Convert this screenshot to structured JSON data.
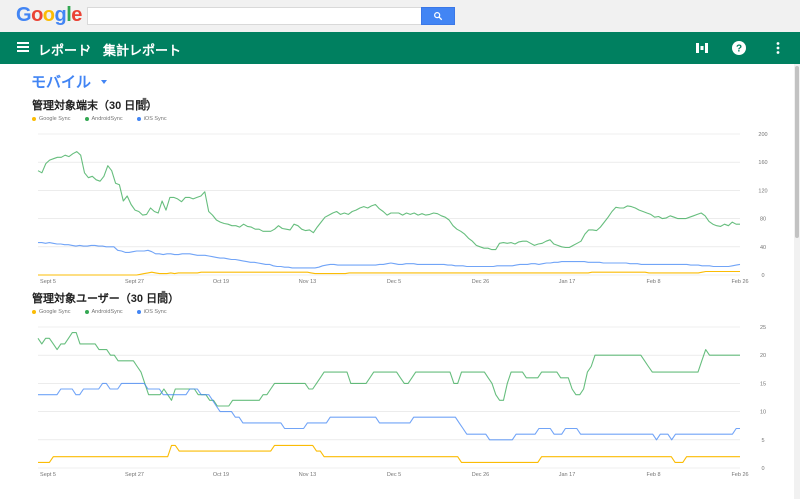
{
  "header": {
    "logo": [
      "G",
      "o",
      "o",
      "g",
      "l",
      "e"
    ],
    "logo_colors": [
      "#4285f4",
      "#ea4335",
      "#fbbc05",
      "#4285f4",
      "#34a853",
      "#ea4335"
    ],
    "search_placeholder": "",
    "search_button_icon": "search-icon"
  },
  "appbar": {
    "menu_icon": "menu-icon",
    "breadcrumb": [
      "レポート",
      "集計レポート"
    ],
    "separator": "›",
    "icons": [
      "reports-icon",
      "help-icon",
      "more-vert-icon"
    ],
    "color": "#008060"
  },
  "section": {
    "title": "モバイル"
  },
  "colors": {
    "google_sync": "#fbbc05",
    "android_sync": "#34a853",
    "ios_sync": "#4285f4"
  },
  "chart_data": [
    {
      "type": "line",
      "title": "管理対象端末（30 日間）",
      "legend": [
        "Google Sync",
        "AndroidSync",
        "iOS Sync"
      ],
      "legend_placement": "top-left",
      "x_ticks": [
        "Sept 5",
        "Sept 27",
        "Oct 19",
        "Nov 13",
        "Dec 5",
        "Dec 26",
        "Jan 17",
        "Feb 8",
        "Feb 26"
      ],
      "ylim": [
        0,
        200
      ],
      "y_ticks": [
        0,
        40,
        80,
        120,
        160,
        200
      ],
      "grid": true,
      "series": [
        {
          "name": "Google Sync",
          "values": [
            0,
            0,
            0,
            0,
            0,
            0,
            0,
            0,
            0,
            0,
            0,
            0,
            0,
            0,
            0,
            0,
            0,
            0,
            0,
            0,
            0,
            0,
            0,
            0,
            0,
            0,
            0,
            1,
            2,
            3,
            4,
            3,
            2,
            2,
            2,
            3,
            2,
            3,
            3,
            3,
            3,
            3,
            3,
            4,
            4,
            4,
            4,
            4,
            4,
            4,
            4,
            4,
            4,
            4,
            4,
            4,
            4,
            4,
            4,
            4,
            4,
            4,
            4,
            4,
            4,
            4,
            4,
            4,
            4,
            4,
            4,
            4,
            3,
            2,
            2,
            2,
            2,
            2,
            2,
            2,
            2,
            2,
            3,
            3,
            3,
            3,
            3,
            3,
            3,
            3,
            3,
            3,
            3,
            3,
            3,
            3,
            3,
            3,
            3,
            3,
            3,
            3,
            3,
            3,
            3,
            3,
            3,
            3,
            3,
            3,
            3,
            3,
            3,
            3,
            3,
            3,
            3,
            3,
            3,
            3,
            3,
            3,
            3,
            3,
            3,
            3,
            3,
            3,
            3,
            3,
            3,
            3,
            3,
            3,
            3,
            3,
            3,
            3,
            3,
            3,
            3,
            3,
            3,
            3,
            3,
            3,
            4,
            4,
            4,
            4,
            4,
            4,
            4,
            4,
            4,
            4,
            4,
            4,
            4,
            4,
            4,
            3,
            3,
            3,
            3,
            3,
            3,
            3,
            3,
            3,
            3,
            3,
            3,
            3,
            3,
            4,
            5,
            5,
            5,
            5,
            5,
            5,
            5,
            5,
            5,
            5
          ]
        },
        {
          "name": "AndroidSync",
          "values": [
            148,
            145,
            158,
            163,
            165,
            167,
            167,
            170,
            168,
            172,
            175,
            170,
            145,
            138,
            140,
            135,
            133,
            140,
            155,
            148,
            130,
            128,
            105,
            112,
            100,
            92,
            90,
            85,
            86,
            95,
            90,
            88,
            105,
            92,
            110,
            110,
            108,
            104,
            110,
            110,
            108,
            110,
            112,
            118,
            90,
            85,
            78,
            75,
            73,
            72,
            70,
            70,
            68,
            72,
            69,
            68,
            65,
            65,
            62,
            62,
            62,
            65,
            70,
            66,
            65,
            64,
            72,
            70,
            65,
            63,
            64,
            60,
            68,
            75,
            82,
            85,
            88,
            90,
            86,
            88,
            86,
            90,
            92,
            95,
            97,
            95,
            98,
            100,
            94,
            90,
            85,
            88,
            88,
            88,
            85,
            88,
            86,
            88,
            85,
            87,
            85,
            86,
            88,
            87,
            84,
            82,
            78,
            70,
            65,
            62,
            58,
            52,
            48,
            42,
            40,
            38,
            38,
            36,
            36,
            45,
            46,
            45,
            46,
            44,
            47,
            48,
            48,
            45,
            42,
            44,
            45,
            48,
            50,
            44,
            42,
            40,
            39,
            39,
            42,
            45,
            48,
            58,
            64,
            64,
            63,
            68,
            75,
            82,
            90,
            96,
            95,
            95,
            98,
            97,
            95,
            92,
            90,
            88,
            86,
            82,
            83,
            80,
            81,
            84,
            82,
            80,
            80,
            80,
            82,
            84,
            86,
            88,
            84,
            76,
            72,
            70,
            69,
            72,
            70,
            75,
            72,
            72
          ]
        },
        {
          "name": "iOS Sync",
          "values": [
            46,
            46,
            45,
            46,
            45,
            44,
            44,
            43,
            43,
            42,
            41,
            42,
            41,
            41,
            42,
            42,
            41,
            41,
            40,
            40,
            40,
            35,
            34,
            32,
            32,
            33,
            34,
            34,
            34,
            35,
            33,
            30,
            30,
            29,
            30,
            30,
            29,
            29,
            30,
            30,
            30,
            29,
            28,
            28,
            28,
            27,
            26,
            25,
            24,
            24,
            23,
            22,
            22,
            21,
            20,
            19,
            18,
            18,
            17,
            16,
            15,
            15,
            13,
            12,
            12,
            11,
            11,
            10,
            10,
            10,
            10,
            10,
            10,
            10,
            11,
            13,
            14,
            15,
            15,
            14,
            14,
            14,
            14,
            14,
            14,
            14,
            14,
            14,
            14,
            14,
            15,
            15,
            16,
            17,
            16,
            15,
            15,
            16,
            16,
            16,
            15,
            15,
            15,
            15,
            15,
            15,
            15,
            15,
            14,
            14,
            13,
            13,
            13,
            12,
            12,
            12,
            12,
            12,
            12,
            12,
            12,
            13,
            13,
            13,
            13,
            13,
            14,
            15,
            15,
            15,
            16,
            16,
            15,
            16,
            17,
            17,
            18,
            18,
            19,
            19,
            19,
            19,
            19,
            19,
            19,
            18,
            18,
            18,
            18,
            17,
            17,
            17,
            17,
            17,
            17,
            17,
            16,
            16,
            16,
            15,
            15,
            15,
            15,
            15,
            15,
            15,
            15,
            15,
            15,
            15,
            15,
            15,
            14,
            14,
            14,
            13,
            13,
            13,
            12,
            12,
            12,
            12,
            12,
            13,
            14,
            15
          ]
        }
      ]
    },
    {
      "type": "line",
      "title": "管理対象ユーザー（30 日間）",
      "legend": [
        "Google Sync",
        "AndroidSync",
        "iOS Sync"
      ],
      "legend_placement": "top-left",
      "x_ticks": [
        "Sept 5",
        "Sept 27",
        "Oct 19",
        "Nov 13",
        "Dec 5",
        "Dec 26",
        "Jan 17",
        "Feb 8",
        "Feb 26"
      ],
      "ylim": [
        0,
        25
      ],
      "y_ticks": [
        0,
        5,
        10,
        15,
        20,
        25
      ],
      "grid": true,
      "series": [
        {
          "name": "Google Sync",
          "values": [
            1,
            1,
            1,
            1,
            2,
            2,
            2,
            2,
            2,
            2,
            2,
            2,
            2,
            2,
            2,
            2,
            2,
            2,
            2,
            2,
            2,
            2,
            2,
            2,
            2,
            2,
            2,
            2,
            2,
            2,
            2,
            2,
            2,
            2,
            2,
            4,
            4,
            3,
            3,
            3,
            3,
            3,
            3,
            3,
            3,
            3,
            3,
            3,
            3,
            3,
            3,
            3,
            3,
            3,
            3,
            3,
            3,
            3,
            3,
            3,
            3,
            3,
            4,
            4,
            4,
            4,
            4,
            4,
            4,
            4,
            4,
            4,
            4,
            3,
            3,
            2,
            2,
            2,
            2,
            2,
            2,
            2,
            2,
            2,
            2,
            2,
            2,
            2,
            2,
            2,
            2,
            2,
            2,
            2,
            2,
            2,
            2,
            2,
            2,
            2,
            2,
            2,
            2,
            2,
            2,
            2,
            2,
            2,
            2,
            2,
            2,
            1,
            1,
            1,
            1,
            1,
            1,
            1,
            1,
            1,
            1,
            1,
            1,
            1,
            1,
            1,
            1,
            1,
            1,
            1,
            1,
            1,
            2,
            2,
            2,
            2,
            2,
            2,
            2,
            2,
            2,
            2,
            2,
            2,
            2,
            2,
            2,
            2,
            2,
            2,
            2,
            2,
            2,
            2,
            2,
            2,
            2,
            2,
            2,
            2,
            2,
            2,
            2,
            2,
            2,
            2,
            2,
            1,
            1,
            1,
            2,
            2,
            2,
            2,
            2,
            2,
            2,
            2,
            2,
            2,
            2,
            2,
            2,
            2,
            2
          ]
        },
        {
          "name": "AndroidSync",
          "values": [
            23,
            22,
            23,
            23,
            22,
            21,
            22,
            22,
            23,
            24,
            24,
            22,
            22,
            22,
            22,
            22,
            21,
            21,
            21,
            20,
            20,
            19,
            19,
            19,
            19,
            19,
            18,
            17,
            15,
            13,
            13,
            13,
            13,
            14,
            13,
            12,
            14,
            14,
            14,
            14,
            14,
            14,
            13,
            13,
            13,
            12,
            12,
            11,
            11,
            11,
            11,
            12,
            12,
            12,
            12,
            12,
            12,
            12,
            12,
            13,
            13,
            14,
            15,
            15,
            15,
            15,
            15,
            15,
            15,
            15,
            15,
            14,
            14,
            15,
            16,
            17,
            17,
            17,
            17,
            17,
            17,
            17,
            15,
            15,
            15,
            15,
            15,
            16,
            17,
            17,
            17,
            17,
            17,
            17,
            17,
            16,
            15,
            15,
            16,
            17,
            17,
            17,
            17,
            17,
            17,
            17,
            17,
            17,
            17,
            15,
            15,
            17,
            17,
            17,
            17,
            17,
            17,
            17,
            16,
            15,
            13,
            12,
            12,
            15,
            17,
            17,
            17,
            17,
            16,
            16,
            16,
            16,
            17,
            17,
            17,
            17,
            17,
            16,
            16,
            16,
            14,
            13,
            13,
            14,
            17,
            18,
            20,
            20,
            20,
            20,
            20,
            20,
            20,
            20,
            20,
            20,
            20,
            20,
            20,
            19,
            18,
            17,
            17,
            17,
            17,
            17,
            17,
            17,
            17,
            17,
            17,
            17,
            17,
            17,
            19,
            21,
            20,
            20,
            20,
            20,
            20,
            20,
            20,
            20,
            20
          ]
        },
        {
          "name": "iOS Sync",
          "values": [
            13,
            13,
            13,
            13,
            13,
            13,
            14,
            14,
            14,
            14,
            13,
            13,
            14,
            14,
            14,
            14,
            14,
            15,
            15,
            14,
            14,
            14,
            15,
            15,
            15,
            15,
            15,
            15,
            15,
            14,
            14,
            14,
            14,
            13,
            13,
            13,
            13,
            13,
            13,
            13,
            14,
            14,
            14,
            13,
            13,
            13,
            12,
            11,
            10,
            10,
            10,
            10,
            9,
            9,
            8,
            8,
            8,
            8,
            8,
            8,
            8,
            8,
            8,
            8,
            8,
            7,
            7,
            7,
            7,
            7,
            7,
            8,
            8,
            8,
            8,
            8,
            8,
            9,
            9,
            9,
            9,
            9,
            9,
            9,
            9,
            9,
            9,
            9,
            9,
            9,
            8,
            8,
            8,
            8,
            8,
            8,
            8,
            8,
            8,
            9,
            9,
            9,
            9,
            9,
            9,
            9,
            9,
            9,
            9,
            9,
            9,
            8,
            7,
            6,
            6,
            6,
            6,
            6,
            6,
            5,
            5,
            5,
            5,
            5,
            5,
            5,
            6,
            6,
            6,
            6,
            6,
            6,
            7,
            7,
            7,
            7,
            6,
            6,
            6,
            7,
            7,
            7,
            7,
            6,
            6,
            6,
            6,
            6,
            6,
            6,
            6,
            6,
            6,
            6,
            6,
            6,
            6,
            6,
            6,
            6,
            6,
            6,
            6,
            5,
            6,
            6,
            6,
            5,
            6,
            6,
            6,
            6,
            6,
            6,
            6,
            6,
            6,
            6,
            6,
            6,
            6,
            6,
            6,
            6,
            7,
            7
          ]
        }
      ]
    }
  ]
}
